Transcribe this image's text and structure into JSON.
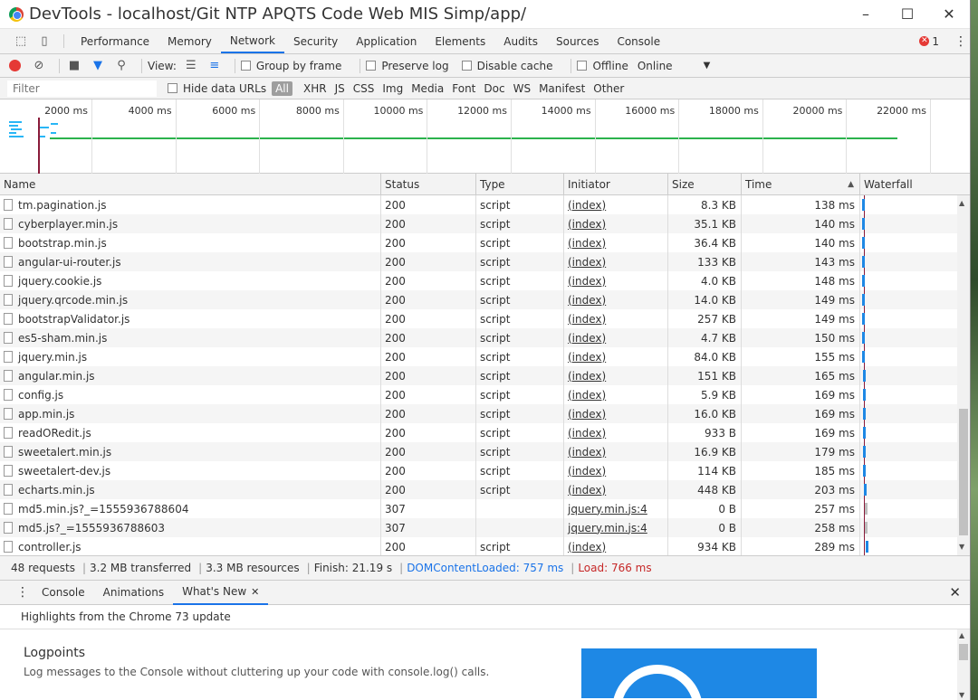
{
  "window": {
    "title": "DevTools - localhost/Git NTP APQTS Code Web MIS Simp/app/"
  },
  "window_controls": {
    "minimize": "–",
    "maximize": "☐",
    "close": "✕"
  },
  "tabs": [
    {
      "label": "Performance"
    },
    {
      "label": "Memory"
    },
    {
      "label": "Network"
    },
    {
      "label": "Security"
    },
    {
      "label": "Application"
    },
    {
      "label": "Elements"
    },
    {
      "label": "Audits"
    },
    {
      "label": "Sources"
    },
    {
      "label": "Console"
    }
  ],
  "active_tab": "Network",
  "error_count": "1",
  "toolbar": {
    "view_label": "View:",
    "group_by_frame": "Group by frame",
    "preserve_log": "Preserve log",
    "disable_cache": "Disable cache",
    "offline": "Offline",
    "throttle": "Online"
  },
  "filter": {
    "placeholder": "Filter",
    "hide_data_urls": "Hide data URLs",
    "types": [
      "All",
      "XHR",
      "JS",
      "CSS",
      "Img",
      "Media",
      "Font",
      "Doc",
      "WS",
      "Manifest",
      "Other"
    ]
  },
  "overview": {
    "ticks": [
      "2000 ms",
      "4000 ms",
      "6000 ms",
      "8000 ms",
      "10000 ms",
      "12000 ms",
      "14000 ms",
      "16000 ms",
      "18000 ms",
      "20000 ms",
      "22000 ms"
    ]
  },
  "columns": {
    "name": "Name",
    "status": "Status",
    "type": "Type",
    "initiator": "Initiator",
    "size": "Size",
    "time": "Time",
    "waterfall": "Waterfall"
  },
  "requests": [
    {
      "name": "tm.pagination.js",
      "status": "200",
      "type": "script",
      "initiator": "(index)",
      "size": "8.3 KB",
      "time": "138 ms"
    },
    {
      "name": "cyberplayer.min.js",
      "status": "200",
      "type": "script",
      "initiator": "(index)",
      "size": "35.1 KB",
      "time": "140 ms"
    },
    {
      "name": "bootstrap.min.js",
      "status": "200",
      "type": "script",
      "initiator": "(index)",
      "size": "36.4 KB",
      "time": "140 ms"
    },
    {
      "name": "angular-ui-router.js",
      "status": "200",
      "type": "script",
      "initiator": "(index)",
      "size": "133 KB",
      "time": "143 ms"
    },
    {
      "name": "jquery.cookie.js",
      "status": "200",
      "type": "script",
      "initiator": "(index)",
      "size": "4.0 KB",
      "time": "148 ms"
    },
    {
      "name": "jquery.qrcode.min.js",
      "status": "200",
      "type": "script",
      "initiator": "(index)",
      "size": "14.0 KB",
      "time": "149 ms"
    },
    {
      "name": "bootstrapValidator.js",
      "status": "200",
      "type": "script",
      "initiator": "(index)",
      "size": "257 KB",
      "time": "149 ms"
    },
    {
      "name": "es5-sham.min.js",
      "status": "200",
      "type": "script",
      "initiator": "(index)",
      "size": "4.7 KB",
      "time": "150 ms"
    },
    {
      "name": "jquery.min.js",
      "status": "200",
      "type": "script",
      "initiator": "(index)",
      "size": "84.0 KB",
      "time": "155 ms"
    },
    {
      "name": "angular.min.js",
      "status": "200",
      "type": "script",
      "initiator": "(index)",
      "size": "151 KB",
      "time": "165 ms"
    },
    {
      "name": "config.js",
      "status": "200",
      "type": "script",
      "initiator": "(index)",
      "size": "5.9 KB",
      "time": "169 ms"
    },
    {
      "name": "app.min.js",
      "status": "200",
      "type": "script",
      "initiator": "(index)",
      "size": "16.0 KB",
      "time": "169 ms"
    },
    {
      "name": "readORedit.js",
      "status": "200",
      "type": "script",
      "initiator": "(index)",
      "size": "933 B",
      "time": "169 ms"
    },
    {
      "name": "sweetalert.min.js",
      "status": "200",
      "type": "script",
      "initiator": "(index)",
      "size": "16.9 KB",
      "time": "179 ms"
    },
    {
      "name": "sweetalert-dev.js",
      "status": "200",
      "type": "script",
      "initiator": "(index)",
      "size": "114 KB",
      "time": "185 ms"
    },
    {
      "name": "echarts.min.js",
      "status": "200",
      "type": "script",
      "initiator": "(index)",
      "size": "448 KB",
      "time": "203 ms"
    },
    {
      "name": "md5.min.js?_=1555936788604",
      "status": "307",
      "type": "",
      "initiator": "jquery.min.js:4",
      "size": "0 B",
      "time": "257 ms"
    },
    {
      "name": "md5.js?_=1555936788603",
      "status": "307",
      "type": "",
      "initiator": "jquery.min.js:4",
      "size": "0 B",
      "time": "258 ms"
    },
    {
      "name": "controller.js",
      "status": "200",
      "type": "script",
      "initiator": "(index)",
      "size": "934 KB",
      "time": "289 ms"
    }
  ],
  "status_bar": {
    "requests": "48 requests",
    "transferred": "3.2 MB transferred",
    "resources": "3.3 MB resources",
    "finish": "Finish: 21.19 s",
    "dcl": "DOMContentLoaded: 757 ms",
    "load": "Load: 766 ms"
  },
  "drawer": {
    "tabs": [
      "Console",
      "Animations",
      "What's New"
    ],
    "active": "What's New",
    "highlight": "Highlights from the Chrome 73 update",
    "item_title": "Logpoints",
    "item_desc": "Log messages to the Console without cluttering up your code with console.log() calls."
  }
}
